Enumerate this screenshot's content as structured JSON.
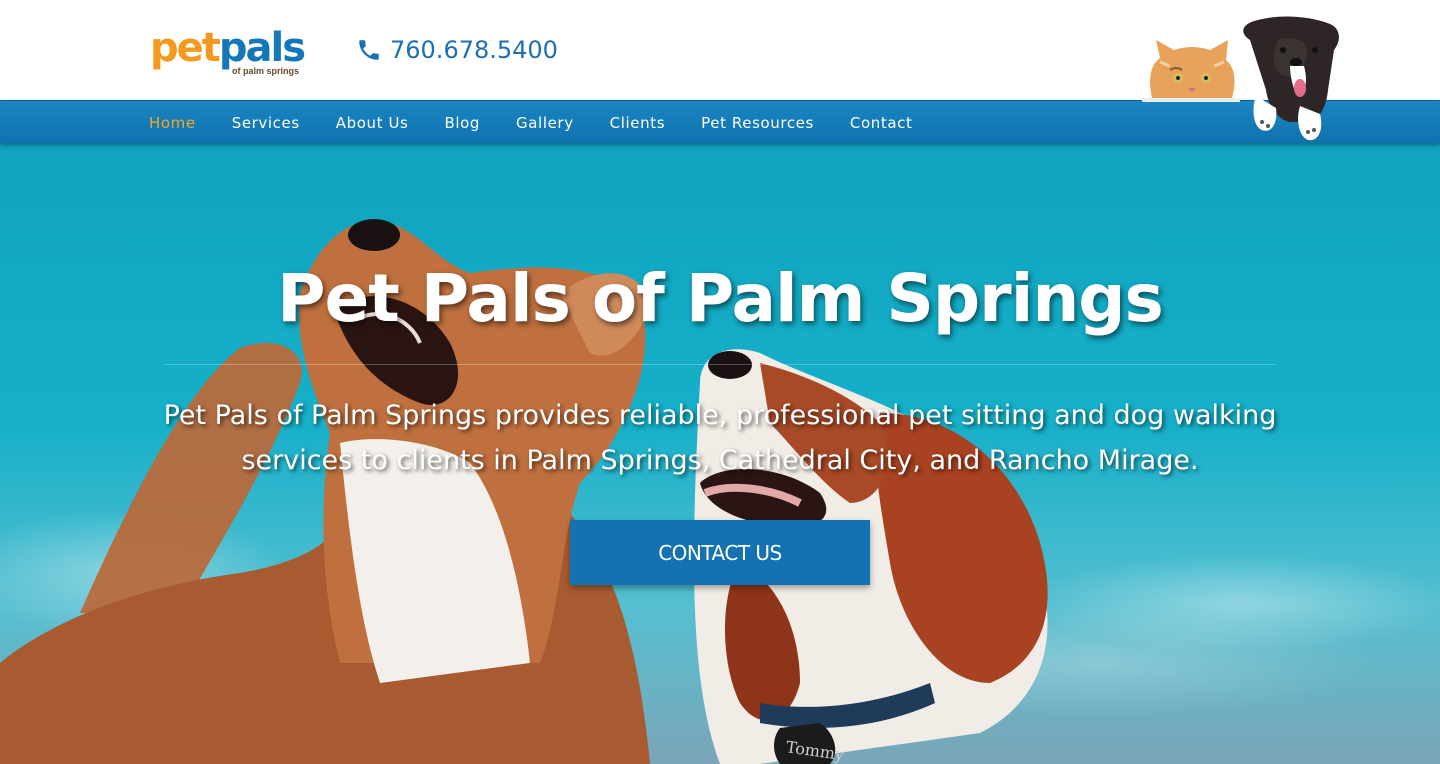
{
  "header": {
    "logo_pet": "pet",
    "logo_pals": "pals",
    "logo_sub": "of palm springs",
    "phone": "760.678.5400"
  },
  "nav": {
    "items": [
      {
        "label": "Home",
        "active": true
      },
      {
        "label": "Services",
        "active": false
      },
      {
        "label": "About Us",
        "active": false
      },
      {
        "label": "Blog",
        "active": false
      },
      {
        "label": "Gallery",
        "active": false
      },
      {
        "label": "Clients",
        "active": false
      },
      {
        "label": "Pet Resources",
        "active": false
      },
      {
        "label": "Contact",
        "active": false
      }
    ]
  },
  "hero": {
    "title": "Pet Pals of Palm Springs",
    "description": "Pet Pals of Palm Springs provides reliable, professional pet sitting and dog walking services to clients in Palm Springs, Cathedral City, and Rancho Mirage.",
    "cta_label": "CONTACT US",
    "tag_text": "Tommy"
  },
  "colors": {
    "brand_blue": "#1478b8",
    "brand_orange": "#f39a1e",
    "nav_active": "#f5a623",
    "nav_bg": "#1a86c3",
    "cta_bg": "#1472b3"
  },
  "icons": {
    "phone": "phone-icon",
    "paw": "paw-icon"
  }
}
